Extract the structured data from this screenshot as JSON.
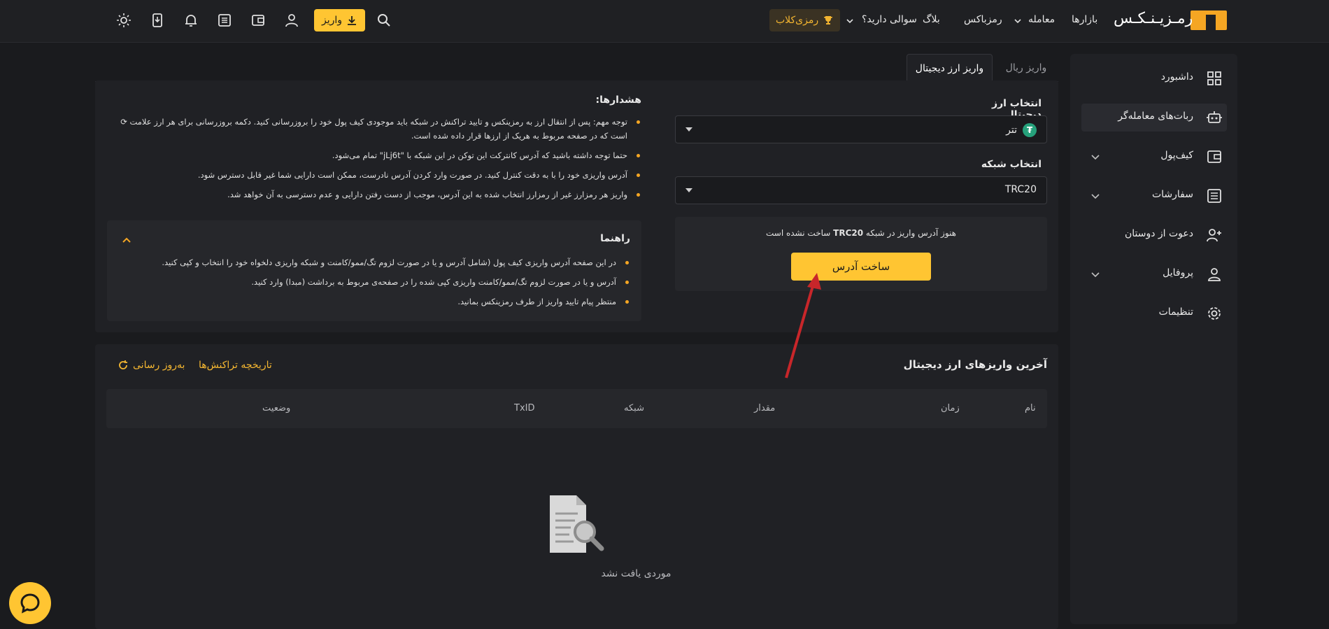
{
  "header": {
    "logo_text": "رمـزیـنـکـس",
    "nav": [
      {
        "label": "بازارها"
      },
      {
        "label": "معامله"
      },
      {
        "label": "رمزباکس"
      },
      {
        "label": "بلاگ"
      },
      {
        "label": "سوالی دارید؟"
      }
    ],
    "club_label": "رمزی‌کلاب",
    "deposit_label": "واریز",
    "icons": [
      "search-icon",
      "user-icon",
      "wallet-icon",
      "orders-icon",
      "bell-icon",
      "download-app-icon",
      "theme-sun-icon"
    ]
  },
  "sidebar": {
    "items": [
      {
        "label": "داشبورد",
        "icon": "dashboard-grid-icon"
      },
      {
        "label": "ربات‌های معامله‌گر",
        "icon": "robot-icon"
      },
      {
        "label": "کیف‌پول",
        "icon": "wallet-icon"
      },
      {
        "label": "سفارشات",
        "icon": "orders-list-icon"
      },
      {
        "label": "دعوت از دوستان",
        "icon": "invite-user-icon"
      },
      {
        "label": "پروفایل",
        "icon": "profile-icon"
      },
      {
        "label": "تنظیمات",
        "icon": "settings-gear-icon"
      }
    ]
  },
  "tabs": {
    "digital": "واریز ارز دیجیتال",
    "rial": "واریز ریال"
  },
  "form": {
    "currency_label": "انتخاب ارز دیجیتال",
    "currency_value": "تتر",
    "network_label": "انتخاب شبکه",
    "network_value": "TRC20",
    "address_msg_pre": "هنوز آدرس واریز در شبکه ",
    "address_msg_bold": "TRC20",
    "address_msg_post": " ساخت نشده است",
    "build_button": "ساخت آدرس"
  },
  "warnings": {
    "title": "هشدارها:",
    "items": [
      "توجه مهم: پس از انتقال ارز به رمزینکس و تایید تراکنش در شبکه باید موجودی کیف پول خود را بروزرسانی کنید. دکمه بروزرسانی برای هر ارز علامت ⟳ است که در صفحه مربوط به هریک از ارزها قرار داده شده است.",
      "حتما توجه داشته باشید که آدرس کانترکت این توکن در این شبکه با \"jLj6t\" تمام می‌شود.",
      "آدرس واریزی خود را با به دقت کنترل کنید. در صورت وارد کردن آدرس نادرست، ممکن است دارایی شما غیر قابل دسترس شود.",
      "واریز هر رمزارز غیر از رمزارز انتخاب شده به این آدرس، موجب از دست رفتن دارایی و عدم دسترسی به آن خواهد شد."
    ]
  },
  "guide": {
    "title": "راهنما",
    "items": [
      "در این صفحه آدرس واریزی کیف پول (شامل آدرس و یا در صورت لزوم تگ/ممو/کامنت و شبکه واریزی دلخواه خود را انتخاب و کپی کنید.",
      "آدرس و یا در صورت لزوم تگ/ممو/کامنت واریزی کپی شده را در صفحه‌ی مربوط به برداشت (مبدا) وارد کنید.",
      "منتظر پیام تایید واریز از طرف رمزینکس بمانید."
    ]
  },
  "deposits": {
    "title": "آخرین واریزهای ارز دیجیتال",
    "history_link": "تاریخچه تراکنش‌ها",
    "refresh_link": "به‌روز رسانی",
    "columns": [
      "نام",
      "زمان",
      "مقدار",
      "شبکه",
      "TxID",
      "وضعیت"
    ],
    "empty_text": "موردی یافت نشد"
  },
  "colors": {
    "accent": "#ffc532",
    "bg": "#1a1b1e",
    "panel": "#202125",
    "link": "#f5b731",
    "tether": "#26a17b"
  }
}
